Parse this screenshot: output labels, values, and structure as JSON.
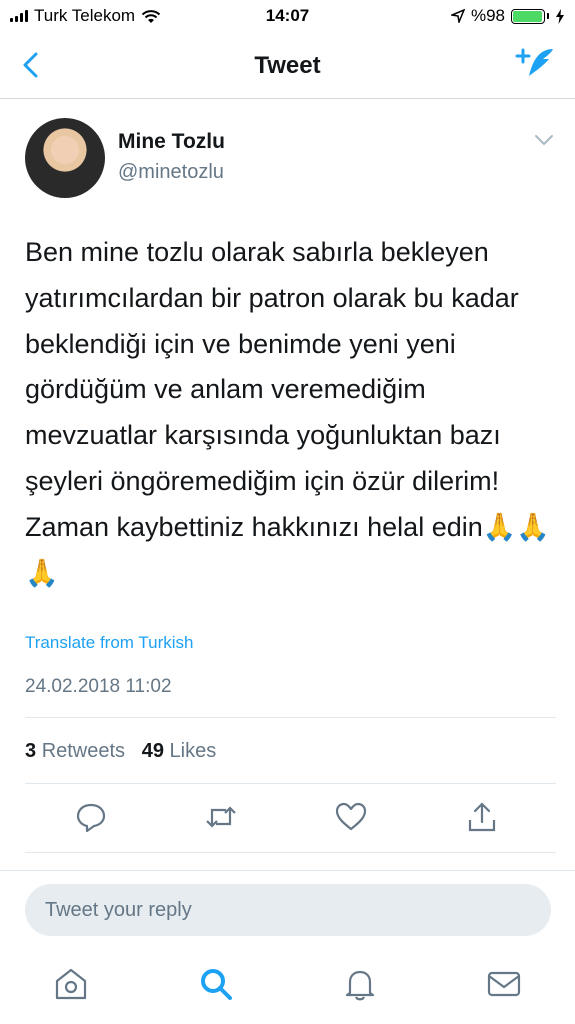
{
  "status_bar": {
    "carrier": "Turk Telekom",
    "time": "14:07",
    "battery": "%98",
    "battery_level": 0.98
  },
  "nav": {
    "title": "Tweet"
  },
  "tweet": {
    "author_name": "Mine Tozlu",
    "author_handle": "@minetozlu",
    "text": "Ben  mine tozlu olarak sabırla bekleyen yatırımcılardan bir patron olarak bu kadar beklendiği için ve benimde yeni yeni gördüğüm ve anlam veremediğim mevzuatlar karşısında yoğunluktan bazı şeyleri öngöremediğim için özür dilerim! Zaman kaybettiniz hakkınızı helal edin🙏🙏🙏",
    "translate": "Translate from Turkish",
    "date": "24.02.2018 11:02",
    "retweets_count": "3",
    "retweets_label": "Retweets",
    "likes_count": "49",
    "likes_label": "Likes"
  },
  "reply": {
    "placeholder": "Tweet your reply"
  },
  "colors": {
    "accent": "#1da1f2",
    "secondary_text": "#657786"
  },
  "icons": {
    "back": "chevron-left-icon",
    "compose": "compose-tweet-icon",
    "more": "chevron-down-icon",
    "reply": "reply-icon",
    "retweet": "retweet-icon",
    "like": "heart-icon",
    "share": "share-icon",
    "home": "home-icon",
    "search": "search-icon",
    "notifications": "bell-icon",
    "messages": "mail-icon"
  }
}
